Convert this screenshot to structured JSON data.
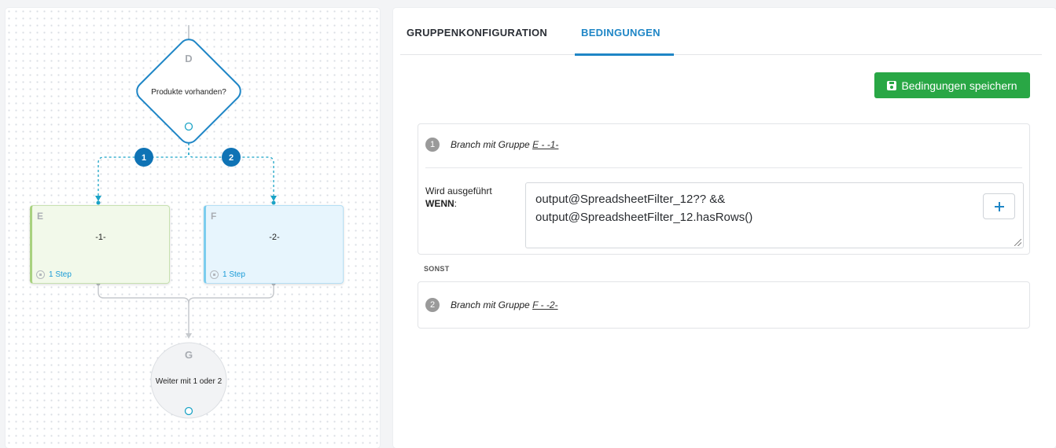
{
  "canvas": {
    "decision_node": {
      "letter": "D",
      "label": "Produkte vorhanden?"
    },
    "branch_badges": [
      "1",
      "2"
    ],
    "groups": [
      {
        "letter": "E",
        "title": "-1-",
        "steps": "1 Step"
      },
      {
        "letter": "F",
        "title": "-2-",
        "steps": "1 Step"
      }
    ],
    "merge_node": {
      "letter": "G",
      "label": "Weiter mit 1 oder 2"
    }
  },
  "tabs": [
    {
      "label": "GRUPPENKONFIGURATION",
      "active": false
    },
    {
      "label": "BEDINGUNGEN",
      "active": true
    }
  ],
  "save_button": {
    "label": "Bedingungen speichern",
    "icon": "floppy-disk-icon"
  },
  "branches": [
    {
      "number": "1",
      "title_prefix": "Branch mit Gruppe",
      "group_ref": "E - -1-",
      "condition_label": "Wird ausgeführt",
      "condition_label_bold": "WENN",
      "condition_label_suffix": ":",
      "condition_line1": "output@SpreadsheetFilter_12?? &&",
      "condition_line2": "output@SpreadsheetFilter_12.hasRows()"
    },
    {
      "number": "2",
      "title_prefix": "Branch mit Gruppe",
      "group_ref": "F - -2-"
    }
  ],
  "else_label": "SONST",
  "colors": {
    "accent_blue": "#1f86c6",
    "save_green": "#29a745",
    "group_e_border": "#a8d27f",
    "group_f_border": "#7ccdee",
    "connector_teal": "#1ba3c6"
  }
}
